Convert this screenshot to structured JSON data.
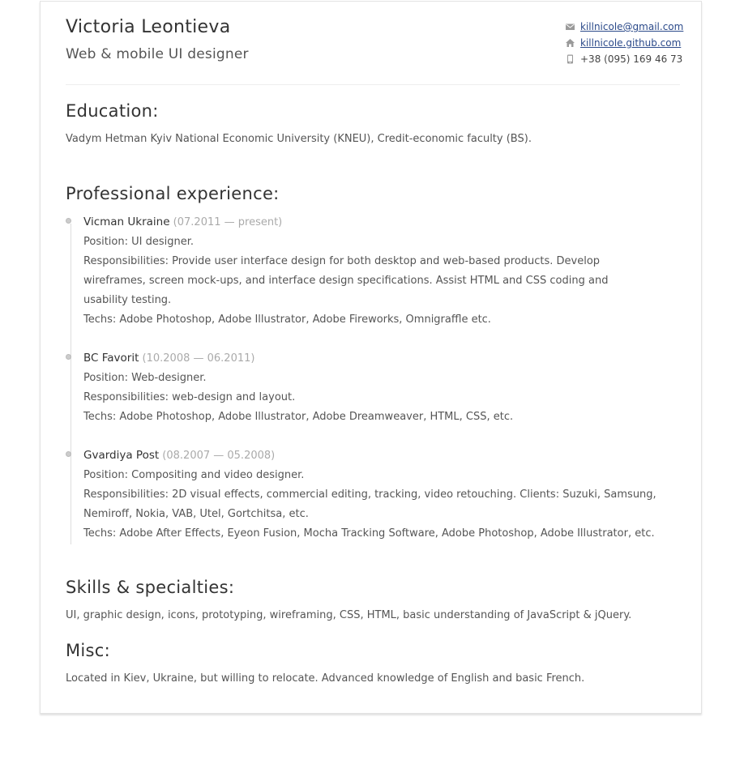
{
  "header": {
    "name": "Victoria Leontieva",
    "title": "Web & mobile UI designer",
    "contacts": {
      "email": "killnicole@gmail.com",
      "site": "killnicole.github.com",
      "phone": "+38 (095) 169 46 73",
      "email_icon": "mail-icon",
      "site_icon": "home-icon",
      "phone_icon": "phone-icon"
    }
  },
  "education": {
    "heading": "Education:",
    "text": "Vadym Hetman Kyiv National Economic University (KNEU), Credit-economic faculty (BS)."
  },
  "experience": {
    "heading": "Professional experience:",
    "jobs": [
      {
        "company": "Vicman Ukraine",
        "dates": "(07.2011 — present)",
        "position": "Position: UI designer.",
        "responsibilities": "Responsibilities: Provide user interface design for both desktop and web-based products. Develop wireframes, screen mock-ups, and interface design specifications. Assist HTML and CSS coding and usability testing.",
        "techs": "Techs: Adobe Photoshop, Adobe Illustrator, Adobe Fireworks, Omnigraffle etc."
      },
      {
        "company": "BC Favorit",
        "dates": "(10.2008 — 06.2011)",
        "position": "Position: Web-designer.",
        "responsibilities": "Responsibilities: web-design and layout.",
        "techs": "Techs: Adobe Photoshop, Adobe Illustrator, Adobe Dreamweaver, HTML, CSS, etc."
      },
      {
        "company": "Gvardiya Post",
        "dates": "(08.2007 — 05.2008)",
        "position": "Position: Compositing and video designer.",
        "responsibilities": "Responsibilities: 2D visual effects, commercial editing, tracking, video retouching. Clients: Suzuki, Samsung, Nemiroff, Nokia, VAB, Utel, Gortchitsa, etc.",
        "techs": "Techs: Adobe After Effects, Eyeon Fusion, Mocha Tracking Software, Adobe Photoshop, Adobe Illustrator, etc."
      }
    ]
  },
  "skills": {
    "heading": "Skills & specialties:",
    "text": "UI, graphic design, icons, prototyping, wireframing, CSS, HTML, basic understanding of JavaScript & jQuery."
  },
  "misc": {
    "heading": "Misc:",
    "text": "Located in Kiev, Ukraine, but willing to relocate. Advanced knowledge of English and basic French."
  },
  "colors": {
    "link": "#2b4a8a",
    "text": "#555555",
    "heading": "#333333",
    "muted": "#aaaaaa"
  }
}
